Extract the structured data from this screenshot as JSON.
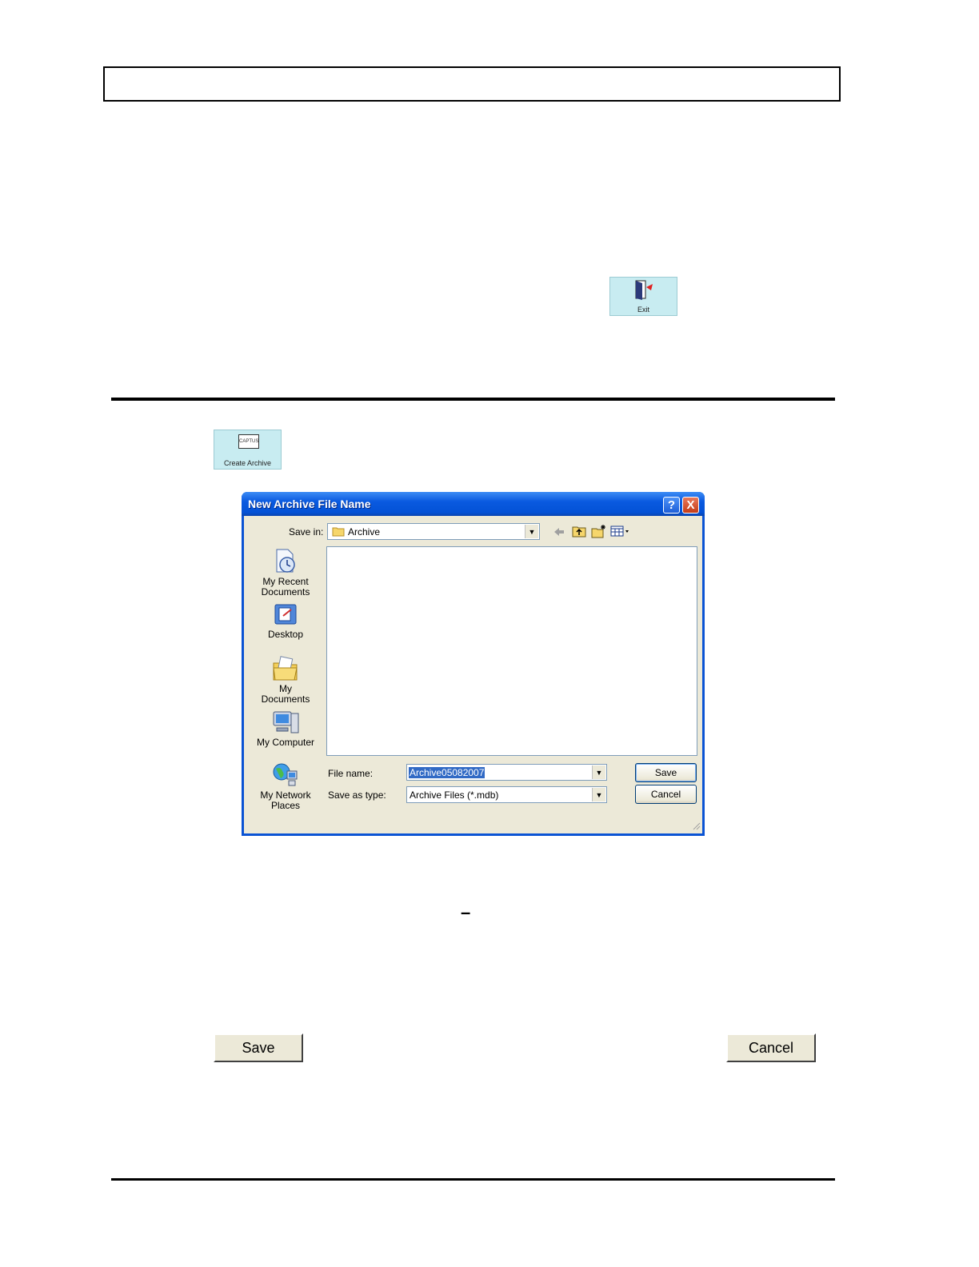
{
  "exit_tile": {
    "label": "Exit"
  },
  "create_archive_tile": {
    "logo_text": "CAPTUS",
    "label": "Create Archive"
  },
  "dialog": {
    "title": "New Archive File Name",
    "help_glyph": "?",
    "close_glyph": "X",
    "save_in_label": "Save in:",
    "save_in_value": "Archive",
    "toolbar_icons": [
      "back-icon",
      "up-folder-icon",
      "new-folder-icon",
      "views-menu-icon"
    ],
    "places": [
      {
        "label_line1": "My Recent",
        "label_line2": "Documents",
        "icon": "recent-documents-icon"
      },
      {
        "label_line1": "Desktop",
        "label_line2": "",
        "icon": "desktop-icon"
      },
      {
        "label_line1": "My Documents",
        "label_line2": "",
        "icon": "my-documents-icon"
      },
      {
        "label_line1": "My Computer",
        "label_line2": "",
        "icon": "my-computer-icon"
      },
      {
        "label_line1": "My Network",
        "label_line2": "Places",
        "icon": "network-places-icon"
      }
    ],
    "file_name_label": "File name:",
    "file_name_value": "Archive05082007",
    "save_as_type_label": "Save as type:",
    "save_as_type_value": "Archive Files (*.mdb)",
    "save_button": "Save",
    "cancel_button": "Cancel"
  },
  "dash_mark": "–",
  "standalone_buttons": {
    "save": "Save",
    "cancel": "Cancel"
  }
}
